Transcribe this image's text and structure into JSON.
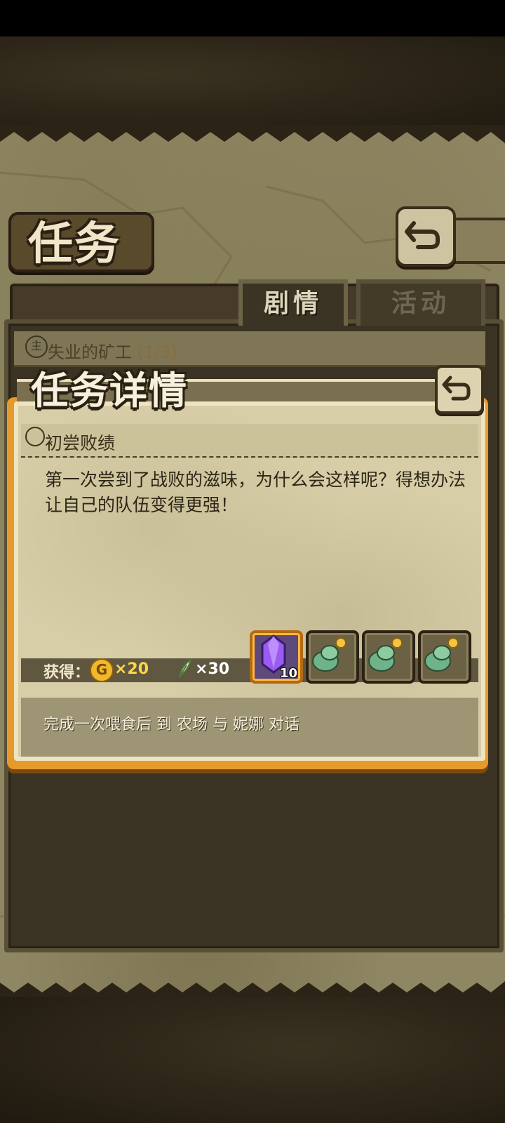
{
  "header": {
    "title": "任务",
    "back_icon": "return-arrow-icon"
  },
  "tabs": [
    {
      "label": "剧情",
      "active": true
    },
    {
      "label": "活动",
      "active": false
    }
  ],
  "quest_list": {
    "item": {
      "name": "失业的矿工",
      "progress": "(1/3)"
    }
  },
  "detail": {
    "title": "任务详情",
    "quest_name": "初尝败绩",
    "description": "第一次尝到了战败的滋味，为什么会这样呢？得想办法让自己的队伍变得更强！",
    "reward_label": "获得：",
    "gold": {
      "icon": "coin-icon",
      "symbol": "G",
      "amount": "×20"
    },
    "feather": {
      "icon": "feather-icon",
      "amount": "×30"
    },
    "items": [
      {
        "icon": "purple-crystal-icon",
        "count": "10"
      },
      {
        "icon": "green-plant-icon",
        "count": ""
      },
      {
        "icon": "green-plant-icon",
        "count": ""
      },
      {
        "icon": "green-plant-icon",
        "count": ""
      }
    ],
    "objective": "完成一次喂食后 到 农场 与 妮娜 对话"
  },
  "colors": {
    "popup_border": "#e79a2c",
    "parchment": "#d7cea8",
    "gold_text": "#ffd54a"
  }
}
